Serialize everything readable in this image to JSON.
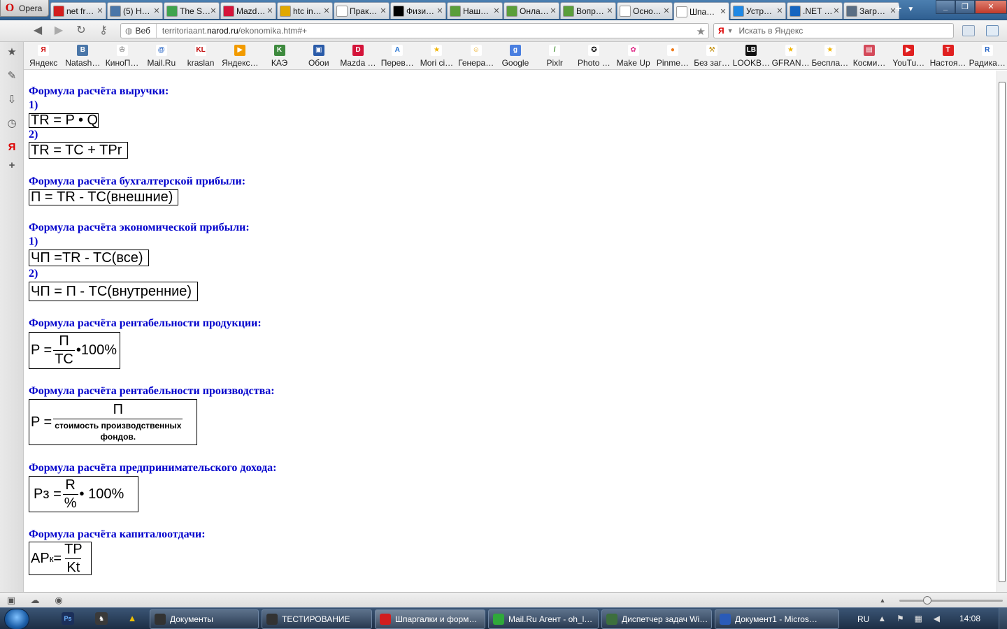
{
  "browser": {
    "menu_label": "Opera",
    "tabs": [
      {
        "title": "net fr…",
        "icon": "opera-red-icon",
        "color": "#d21e1e"
      },
      {
        "title": "(5) Н…",
        "icon": "vk-icon",
        "color": "#4a76a8"
      },
      {
        "title": "The S…",
        "icon": "sims-icon",
        "color": "#3fa34d"
      },
      {
        "title": "Mazd…",
        "icon": "mazda-d-icon",
        "color": "#d4143a"
      },
      {
        "title": "htc in…",
        "icon": "htc-icon",
        "color": "#e0a800"
      },
      {
        "title": "Прак…",
        "icon": "page-icon",
        "color": "#ffffff"
      },
      {
        "title": "Физи…",
        "icon": "pc-icon",
        "color": "#000000"
      },
      {
        "title": "Наш…",
        "icon": "chart-icon",
        "color": "#5a9e3a"
      },
      {
        "title": "Онла…",
        "icon": "chart-icon",
        "color": "#5a9e3a"
      },
      {
        "title": "Вопр…",
        "icon": "chart-icon",
        "color": "#5a9e3a"
      },
      {
        "title": "Осно…",
        "icon": "page-icon",
        "color": "#ffffff"
      },
      {
        "title": "Шпа…",
        "icon": "page-icon",
        "color": "#ffffff",
        "active": true
      },
      {
        "title": "Устр…",
        "icon": "p-icon",
        "color": "#1e88e5"
      },
      {
        "title": ".NET …",
        "icon": "net-icon",
        "color": "#1565c0"
      },
      {
        "title": "Загр…",
        "icon": "download-icon",
        "color": "#5a6e84"
      }
    ],
    "new_tab": "+",
    "address": {
      "badge": "Веб",
      "url_prefix": "territoriaant.",
      "url_domain": "narod.ru",
      "url_suffix": "/ekonomika.htm#+"
    },
    "search_placeholder": "Искать в Яндекс",
    "search_engine": "Я",
    "bookmarks": [
      {
        "label": "Яндекс",
        "icon": "yandex-icon",
        "color": "#ffffff",
        "glyph": "Я",
        "fg": "#d00000"
      },
      {
        "label": "Natash…",
        "icon": "vk-icon",
        "color": "#4a76a8",
        "glyph": "В",
        "fg": "#ffffff"
      },
      {
        "label": "КиноП…",
        "icon": "film-icon",
        "color": "#ffffff",
        "glyph": "✇",
        "fg": "#555555"
      },
      {
        "label": "Mail.Ru",
        "icon": "mail-at-icon",
        "color": "#ffffff",
        "glyph": "@",
        "fg": "#1e5fc4"
      },
      {
        "label": "kraslan",
        "icon": "kl-icon",
        "color": "#ffffff",
        "glyph": "KL",
        "fg": "#c00000"
      },
      {
        "label": "Яндекс…",
        "icon": "yandex-market-icon",
        "color": "#f29b00",
        "glyph": "▶",
        "fg": "#ffffff"
      },
      {
        "label": "КАЭ",
        "icon": "kae-icon",
        "color": "#3e8a3e",
        "glyph": "K",
        "fg": "#ffffff"
      },
      {
        "label": "Обои",
        "icon": "wallpaper-icon",
        "color": "#2a5ba8",
        "glyph": "▣",
        "fg": "#ffffff"
      },
      {
        "label": "Mazda …",
        "icon": "mazda-d-icon",
        "color": "#d4143a",
        "glyph": "D",
        "fg": "#ffffff"
      },
      {
        "label": "Перев…",
        "icon": "translate-icon",
        "color": "#ffffff",
        "glyph": "A",
        "fg": "#1e6fd0"
      },
      {
        "label": "Mori ci…",
        "icon": "star-icon",
        "color": "#ffffff",
        "glyph": "★",
        "fg": "#f0b400"
      },
      {
        "label": "Генера…",
        "icon": "smiley-icon",
        "color": "#ffffff",
        "glyph": "☺",
        "fg": "#e8a000"
      },
      {
        "label": "Google",
        "icon": "google-icon",
        "color": "#4a7fe0",
        "glyph": "g",
        "fg": "#ffffff"
      },
      {
        "label": "Pixlr",
        "icon": "brush-icon",
        "color": "#ffffff",
        "glyph": "/",
        "fg": "#3b8a2a"
      },
      {
        "label": "Photo …",
        "icon": "photo-star-icon",
        "color": "#ffffff",
        "glyph": "✪",
        "fg": "#000000"
      },
      {
        "label": "Make Up",
        "icon": "flower-icon",
        "color": "#ffffff",
        "glyph": "✿",
        "fg": "#e0308a"
      },
      {
        "label": "Pinme…",
        "icon": "pin-icon",
        "color": "#ffffff",
        "glyph": "●",
        "fg": "#f07a1a"
      },
      {
        "label": "Без заг…",
        "icon": "tools-icon",
        "color": "#ffffff",
        "glyph": "⚒",
        "fg": "#c08a00"
      },
      {
        "label": "LOOKB…",
        "icon": "lb-icon",
        "color": "#111111",
        "glyph": "LB",
        "fg": "#ffffff"
      },
      {
        "label": "GFRAN…",
        "icon": "star-icon",
        "color": "#ffffff",
        "glyph": "★",
        "fg": "#f0b400"
      },
      {
        "label": "Беспла…",
        "icon": "star-icon",
        "color": "#ffffff",
        "glyph": "★",
        "fg": "#f0b400"
      },
      {
        "label": "Косми…",
        "icon": "cosmetics-icon",
        "color": "#d44a5a",
        "glyph": "▤",
        "fg": "#ffffff"
      },
      {
        "label": "YouTu…",
        "icon": "youtube-icon",
        "color": "#e02020",
        "glyph": "▶",
        "fg": "#ffffff"
      },
      {
        "label": "Настоя…",
        "icon": "t-icon",
        "color": "#e02020",
        "glyph": "T",
        "fg": "#ffffff"
      },
      {
        "label": "Радика…",
        "icon": "radio-icon",
        "color": "#ffffff",
        "glyph": "R",
        "fg": "#1e5fc4"
      }
    ]
  },
  "page": {
    "sections": [
      {
        "heading": "Формула расчёта выручки:",
        "items": [
          "1)",
          "2)"
        ]
      },
      {
        "heading": "Формула расчёта бухгалтерской прибыли:"
      },
      {
        "heading": "Формула расчёта экономической прибыли:",
        "items": [
          "1)",
          "2)"
        ]
      },
      {
        "heading": "Формула расчёта рентабельности продукции:"
      },
      {
        "heading": "Формула расчёта рентабельности производства:"
      },
      {
        "heading": "Формула расчёта предпринимательского дохода:"
      },
      {
        "heading": "Формула расчёта капиталоотдачи:"
      }
    ],
    "formulas": {
      "revenue_1": "TR = P • Q",
      "revenue_2": "TR = TC + TPr",
      "accounting_profit": "П = TR - TC(внешние)",
      "economic_profit_1": "ЧП =TR - TC(все)",
      "economic_profit_2": "ЧП = П - TC(внутренние)",
      "prod_profitability": {
        "lhs": "P =",
        "num": "П",
        "den": "TC",
        "rhs": "•100%"
      },
      "manuf_profitability": {
        "lhs": "P =",
        "num": "П",
        "den_1": "стоимость производственных",
        "den_2": "фондов."
      },
      "entrepreneur_income": {
        "lhs": "Pз =",
        "num": "R",
        "den": "%",
        "rhs": "• 100%"
      },
      "capital_productivity": {
        "lhs": "AP",
        "sub": "к",
        "eq": "=",
        "num": "TP",
        "den": "Kt"
      }
    }
  },
  "taskbar": {
    "items": [
      {
        "label": "Документы",
        "icon": "folder-icon",
        "color": "#333333"
      },
      {
        "label": "ТЕСТИРОВАНИЕ",
        "icon": "folder-icon",
        "color": "#333333"
      },
      {
        "label": "Шпаргалки и форм…",
        "icon": "opera-icon",
        "color": "#d21e1e",
        "active": true
      },
      {
        "label": "Mail.Ru Агент - oh_l…",
        "icon": "mail-agent-icon",
        "color": "#2fa83a"
      },
      {
        "label": "Диспетчер задач Wi…",
        "icon": "task-manager-icon",
        "color": "#3d6f3d"
      },
      {
        "label": "Документ1 - Micros…",
        "icon": "word-icon",
        "color": "#2a5bb8"
      }
    ],
    "language": "RU",
    "clock": "14:08"
  }
}
